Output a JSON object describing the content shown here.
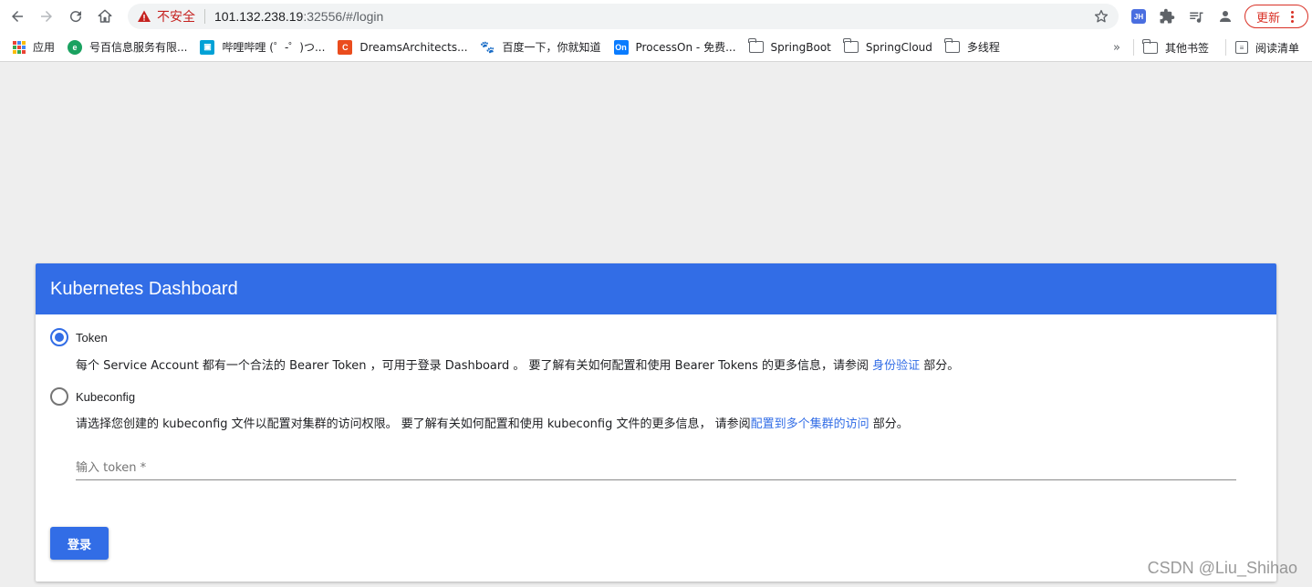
{
  "browser": {
    "security_label": "不安全",
    "url_host": "101.132.238.19",
    "url_rest": ":32556/#/login",
    "update_label": "更新",
    "extension_label": "JH"
  },
  "bookmarks": {
    "apps_label": "应用",
    "items": [
      {
        "label": "号百信息服务有限...",
        "icon": "globe-icon",
        "color": "#1aa260"
      },
      {
        "label": "哔哩哔哩 (゜-゜)つ...",
        "icon": "bilibili-icon",
        "color": "#00a1d6"
      },
      {
        "label": "DreamsArchitects...",
        "icon": "c-icon",
        "color": "#ea4c1d"
      },
      {
        "label": "百度一下，你就知道",
        "icon": "baidu-icon",
        "color": "#2932e1"
      },
      {
        "label": "ProcessOn - 免费...",
        "icon": "processon-icon",
        "color": "#0a7cff"
      },
      {
        "label": "SpringBoot",
        "icon": "folder-icon"
      },
      {
        "label": "SpringCloud",
        "icon": "folder-icon"
      },
      {
        "label": "多线程",
        "icon": "folder-icon"
      }
    ],
    "other_label": "其他书签",
    "reading_list_label": "阅读清单"
  },
  "card": {
    "title": "Kubernetes Dashboard",
    "token_option": {
      "label": "Token",
      "desc_before": "每个 Service Account 都有一个合法的 Bearer Token ，可用于登录 Dashboard 。 要了解有关如何配置和使用 Bearer Tokens 的更多信息，请参阅 ",
      "link": "身份验证",
      "desc_after": " 部分。"
    },
    "kubeconfig_option": {
      "label": "Kubeconfig",
      "desc_before": "请选择您创建的 kubeconfig 文件以配置对集群的访问权限。 要了解有关如何配置和使用 kubeconfig 文件的更多信息， 请参阅",
      "link": "配置到多个集群的访问",
      "desc_after": " 部分。"
    },
    "token_placeholder": "输入 token *",
    "login_label": "登录"
  },
  "watermark": "CSDN @Liu_Shihao",
  "colors": {
    "accent": "#326de6",
    "danger": "#d93025"
  }
}
